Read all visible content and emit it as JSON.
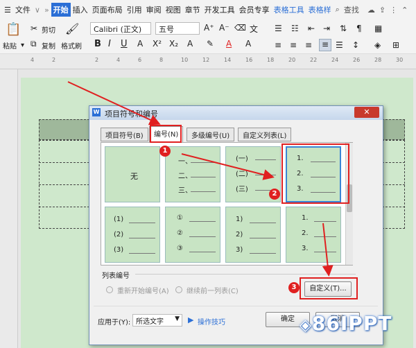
{
  "menubar": {
    "file": "文件",
    "chevron": "»",
    "tabs": [
      "开始",
      "插入",
      "页面布局",
      "引用",
      "审阅",
      "视图",
      "章节",
      "开发工具",
      "会员专享",
      "表格工具",
      "表格样"
    ],
    "active_tab": "开始",
    "search": "查找"
  },
  "ribbon": {
    "cut": "剪切",
    "paste": "粘贴",
    "copy": "复制",
    "format_painter": "格式刷",
    "font_name": "Calibri (正文)",
    "font_size": "五号"
  },
  "ruler": {
    "numbers": [
      "4",
      "2",
      "",
      "2",
      "4",
      "6",
      "8",
      "10",
      "12",
      "14",
      "16",
      "18",
      "20",
      "22",
      "24",
      "26",
      "28",
      "30"
    ]
  },
  "dialog": {
    "title": "项目符号和编号",
    "tabs": [
      "项目符号(B)",
      "编号(N)",
      "多级编号(U)",
      "自定义列表(L)"
    ],
    "selected_tab": "编号(N)",
    "none_label": "无",
    "styles": [
      [
        "一、",
        "二、",
        "三、"
      ],
      [
        "(一)",
        "(二)",
        "(三)"
      ],
      [
        "1.",
        "2.",
        "3."
      ],
      [
        "(1)",
        "(2)",
        "(3)"
      ],
      [
        "①",
        "②",
        "③"
      ],
      [
        "1)",
        "2)",
        "3)"
      ],
      [
        "1.",
        "2.",
        "3."
      ]
    ],
    "list_numbering_label": "列表编号",
    "restart_label": "重新开始编号(A)",
    "continue_label": "继续前一列表(C)",
    "custom_button": "自定义(T)...",
    "apply_to_label": "应用于(Y):",
    "apply_to_value": "所选文字",
    "tips_label": "操作技巧",
    "ok_button": "确定",
    "cancel_button": "取消"
  },
  "annotations": {
    "badge1": "1",
    "badge2": "2",
    "badge3": "3"
  },
  "watermark": "86IPPT",
  "colors": {
    "accent": "#2b6fd6",
    "annotation_red": "#e02020",
    "page_green": "#cfe8cc"
  }
}
